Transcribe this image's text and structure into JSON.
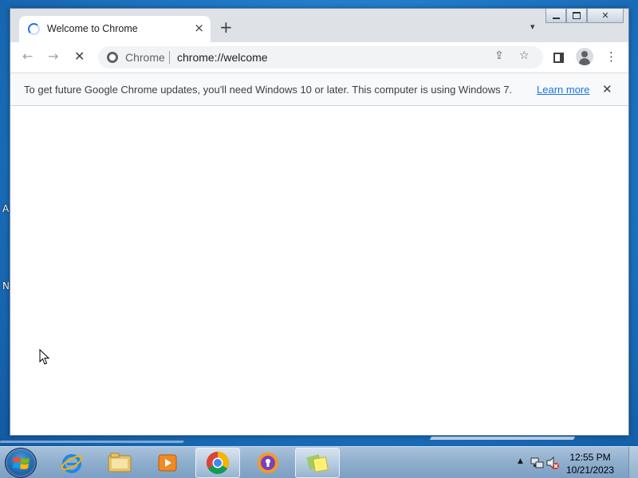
{
  "desktop": {
    "edge_chars": [
      "A",
      "N"
    ]
  },
  "window": {
    "tab": {
      "title": "Welcome to Chrome",
      "close_icon": "×",
      "loading": true
    },
    "new_tab_icon": "+",
    "tab_search_icon": "▾",
    "controls": {
      "close_symbol": "✕"
    },
    "toolbar": {
      "back_icon": "←",
      "forward_icon": "→",
      "stop_icon": "✕",
      "site_chip": "Chrome",
      "url": "chrome://welcome",
      "share_icon": "⇪",
      "bookmark_icon": "☆",
      "menu_icon": "⋮"
    },
    "infobar": {
      "message": "To get future Google Chrome updates, you'll need Windows 10 or later. This computer is using Windows 7.",
      "link": "Learn more",
      "close_icon": "✕"
    }
  },
  "taskbar": {
    "pinned": [
      {
        "name": "Internet Explorer",
        "icon": "internet-explorer-icon"
      },
      {
        "name": "Windows Explorer",
        "icon": "folder-icon"
      },
      {
        "name": "Windows Media Player",
        "icon": "media-player-icon"
      },
      {
        "name": "Google Chrome",
        "icon": "chrome-icon",
        "active": true
      },
      {
        "name": "Avast Secure Browser",
        "icon": "secure-browser-icon"
      },
      {
        "name": "Sticky Notes",
        "icon": "sticky-notes-icon",
        "active": true
      }
    ],
    "tray": {
      "show_hidden_icon": "▲",
      "time": "12:55 PM",
      "date": "10/21/2023"
    }
  },
  "colors": {
    "accent": "#1a73e8",
    "tab_strip": "#dee1e6",
    "desktop": "#1f78c6"
  }
}
